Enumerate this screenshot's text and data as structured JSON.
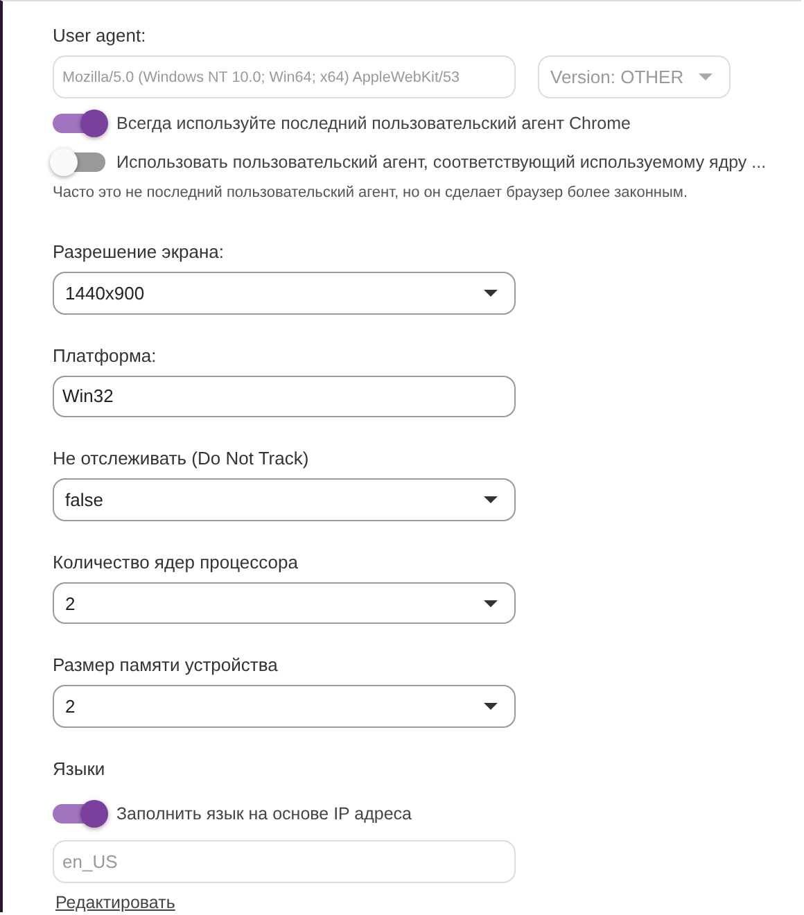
{
  "user_agent": {
    "label": "User agent:",
    "field": {
      "value": "Mozilla/5.0 (Windows NT 10.0; Win64; x64) AppleWebKit/53",
      "disabled": true
    },
    "version": {
      "value": "Version: OTHER",
      "disabled": true
    }
  },
  "toggles": [
    {
      "label": "Всегда используйте последний пользовательский агент Chrome",
      "on": true
    },
    {
      "label": "Использовать пользовательский агент, соответствующий используемому ядру ...",
      "on": false
    }
  ],
  "hint": "Часто это не последний пользовательский агент, но он сделает браузер более законным.",
  "settings": [
    {
      "label": "Разрешение экрана:",
      "kind": "select",
      "value": "1440x900"
    },
    {
      "label": "Платформа:",
      "kind": "text",
      "value": "Win32"
    },
    {
      "label": "Не отслеживать (Do Not Track)",
      "kind": "select",
      "value": "false"
    },
    {
      "label": "Количество ядер процессора",
      "kind": "select",
      "value": "2"
    },
    {
      "label": "Размер памяти устройства",
      "kind": "select",
      "value": "2"
    }
  ],
  "languages": {
    "label": "Языки",
    "toggle": {
      "label": "Заполнить язык на основе IP адреса",
      "on": true
    },
    "field": {
      "value": "en_US",
      "disabled": true
    },
    "link": "Редактировать"
  }
}
